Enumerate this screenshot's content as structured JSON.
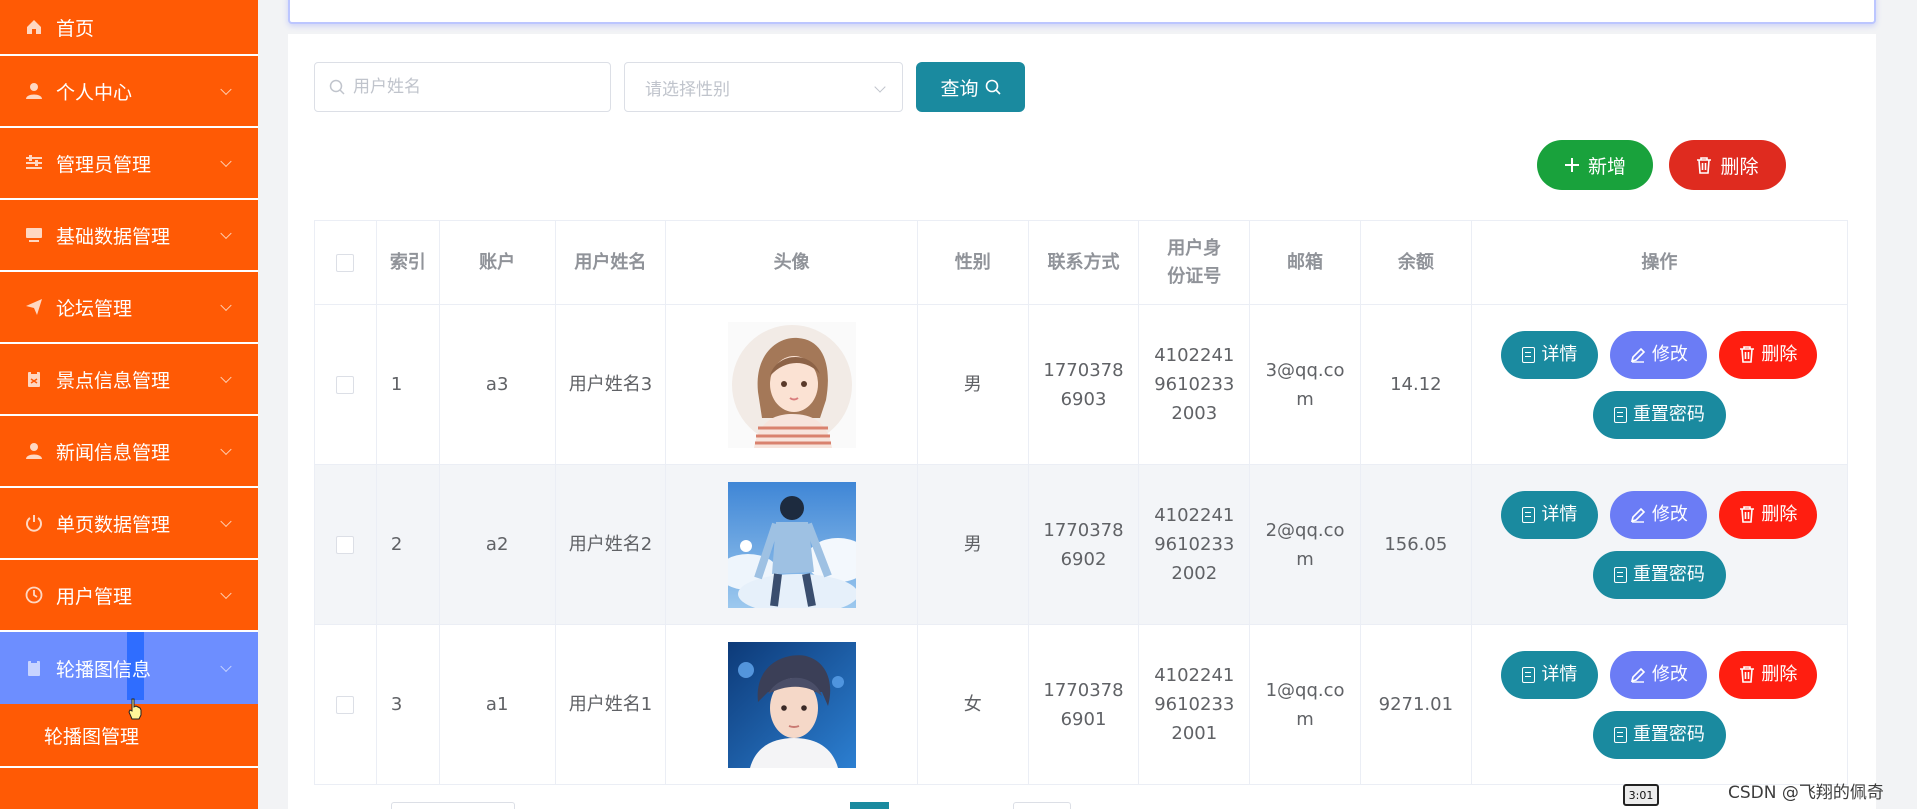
{
  "sidebar": {
    "items": [
      {
        "label": "首页",
        "icon": "home-icon",
        "has_chevron": false
      },
      {
        "label": "个人中心",
        "icon": "user-icon",
        "has_chevron": true
      },
      {
        "label": "管理员管理",
        "icon": "sliders-icon",
        "has_chevron": true
      },
      {
        "label": "基础数据管理",
        "icon": "database-icon",
        "has_chevron": true
      },
      {
        "label": "论坛管理",
        "icon": "send-icon",
        "has_chevron": true
      },
      {
        "label": "景点信息管理",
        "icon": "clipboard-icon",
        "has_chevron": true
      },
      {
        "label": "新闻信息管理",
        "icon": "user-icon",
        "has_chevron": true
      },
      {
        "label": "单页数据管理",
        "icon": "power-icon",
        "has_chevron": true
      },
      {
        "label": "用户管理",
        "icon": "clock-icon",
        "has_chevron": true
      },
      {
        "label": "轮播图信息",
        "icon": "image-icon",
        "has_chevron": true,
        "active": true
      }
    ],
    "submenu_label": "轮播图管理",
    "bg_color": "#ff5a05",
    "active_color": "#6d8eff"
  },
  "search": {
    "name_placeholder": "用户姓名",
    "gender_placeholder": "请选择性别",
    "query_label": "查询"
  },
  "actions": {
    "add_label": "新增",
    "delete_label": "删除"
  },
  "table": {
    "columns": [
      "",
      "索引",
      "账户",
      "用户姓名",
      "头像",
      "性别",
      "联系方式",
      "用户身份证号",
      "邮箱",
      "余额",
      "操作"
    ],
    "rows": [
      {
        "index": "1",
        "account": "a3",
        "name": "用户姓名3",
        "avatar": "illustrated-girl-avatar",
        "gender": "男",
        "phone": "17703786903",
        "id_number": "410224196102332003",
        "email": "3@qq.com",
        "balance": "14.12"
      },
      {
        "index": "2",
        "account": "a2",
        "name": "用户姓名2",
        "avatar": "boy-in-clouds-avatar",
        "gender": "男",
        "phone": "17703786902",
        "id_number": "410224196102332002",
        "email": "2@qq.com",
        "balance": "156.05"
      },
      {
        "index": "3",
        "account": "a1",
        "name": "用户姓名1",
        "avatar": "portrait-photo-avatar",
        "gender": "女",
        "phone": "17703786901",
        "id_number": "410224196102332001",
        "email": "1@qq.com",
        "balance": "9271.01"
      }
    ],
    "row_actions": {
      "detail": "详情",
      "edit": "修改",
      "delete": "删除",
      "reset": "重置密码"
    }
  },
  "colors": {
    "teal": "#1a8a9f",
    "green": "#19a23c",
    "red": "#df2b1f",
    "edit_blue": "#6b7cf5"
  },
  "watermark": "CSDN @飞翔的佩奇",
  "time_badge": "3:01"
}
